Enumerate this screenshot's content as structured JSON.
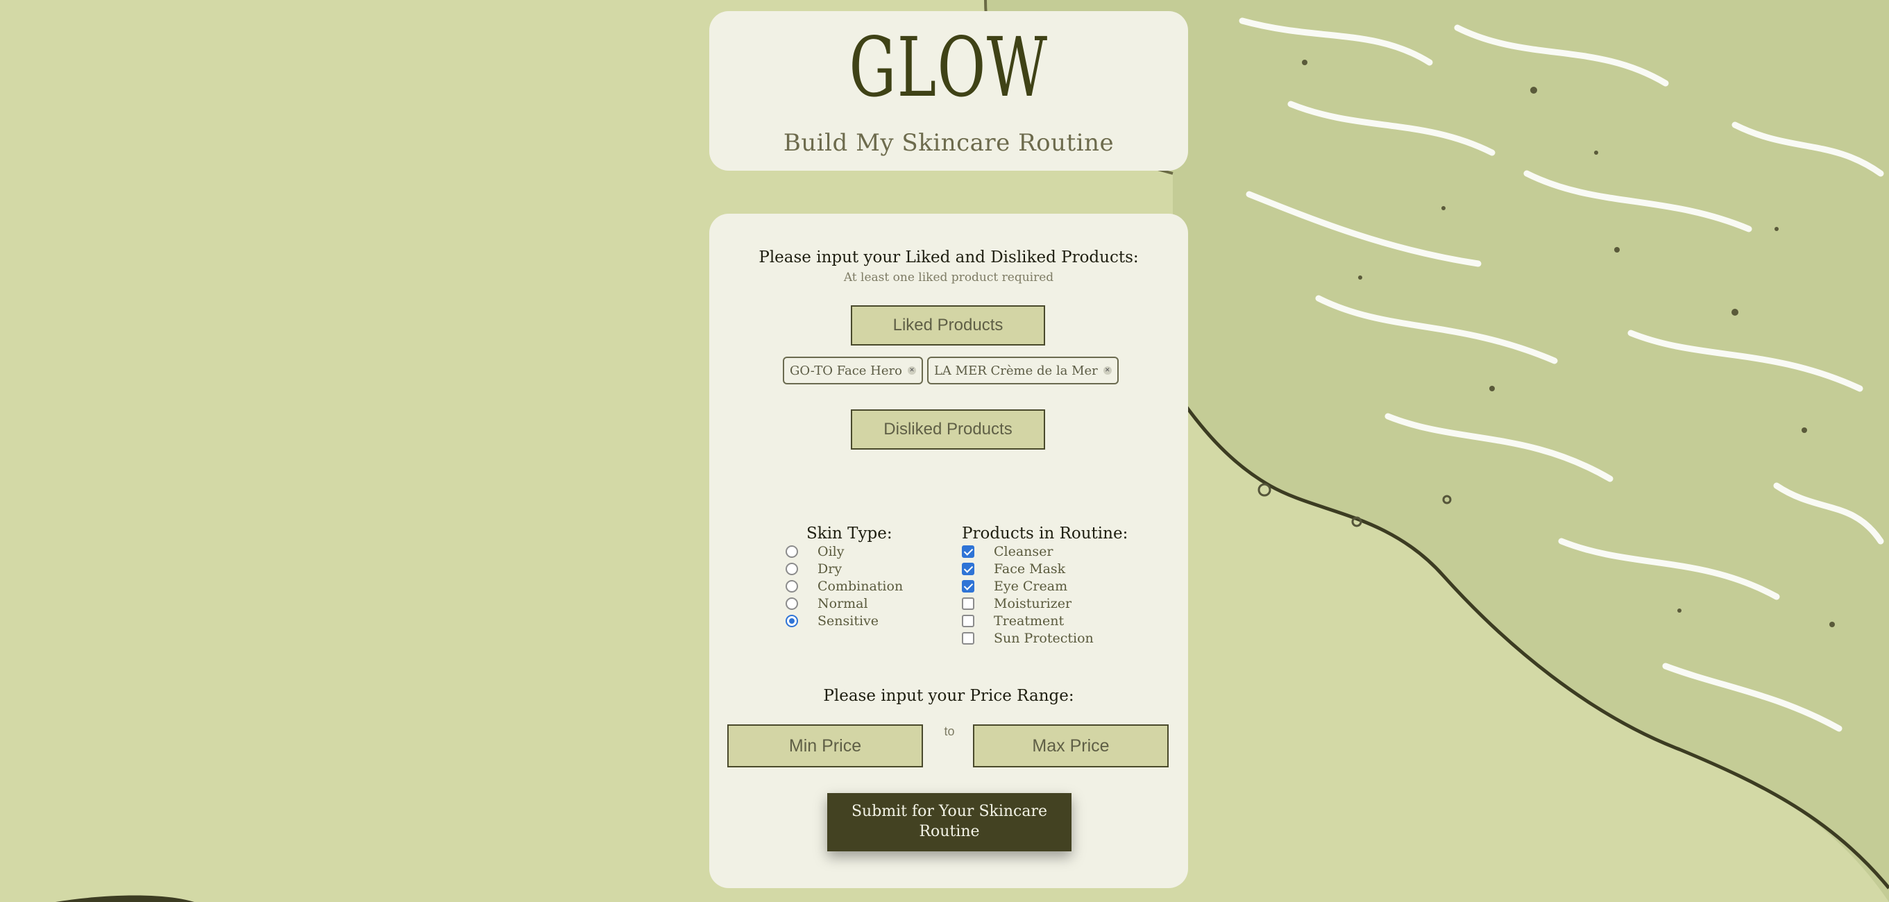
{
  "header": {
    "logo": "GLOW",
    "subtitle": "Build My Skincare Routine"
  },
  "products": {
    "heading": "Please input your Liked and Disliked Products:",
    "note": "At least one liked product required",
    "liked_button": "Liked Products",
    "liked_tags": [
      {
        "label": "GO-TO Face Hero",
        "remove_icon": "x-icon"
      },
      {
        "label": "LA MER Crème de la Mer",
        "remove_icon": "x-icon"
      }
    ],
    "disliked_button": "Disliked Products"
  },
  "skin_type": {
    "heading": "Skin Type:",
    "options": [
      {
        "label": "Oily",
        "selected": false
      },
      {
        "label": "Dry",
        "selected": false
      },
      {
        "label": "Combination",
        "selected": false
      },
      {
        "label": "Normal",
        "selected": false
      },
      {
        "label": "Sensitive",
        "selected": true
      }
    ]
  },
  "routine": {
    "heading": "Products in Routine:",
    "options": [
      {
        "label": "Cleanser",
        "checked": true
      },
      {
        "label": "Face Mask",
        "checked": true
      },
      {
        "label": "Eye Cream",
        "checked": true
      },
      {
        "label": "Moisturizer",
        "checked": false
      },
      {
        "label": "Treatment",
        "checked": false
      },
      {
        "label": "Sun Protection",
        "checked": false
      }
    ]
  },
  "price": {
    "heading": "Please input your Price Range:",
    "min_placeholder": "Min Price",
    "to_label": "to",
    "max_placeholder": "Max Price"
  },
  "submit_label": "Submit for Your Skincare Routine",
  "colors": {
    "background": "#d3d9a6",
    "card": "#f1f1e5",
    "accent_dark": "#434222",
    "control_blue": "#2f74d6"
  }
}
